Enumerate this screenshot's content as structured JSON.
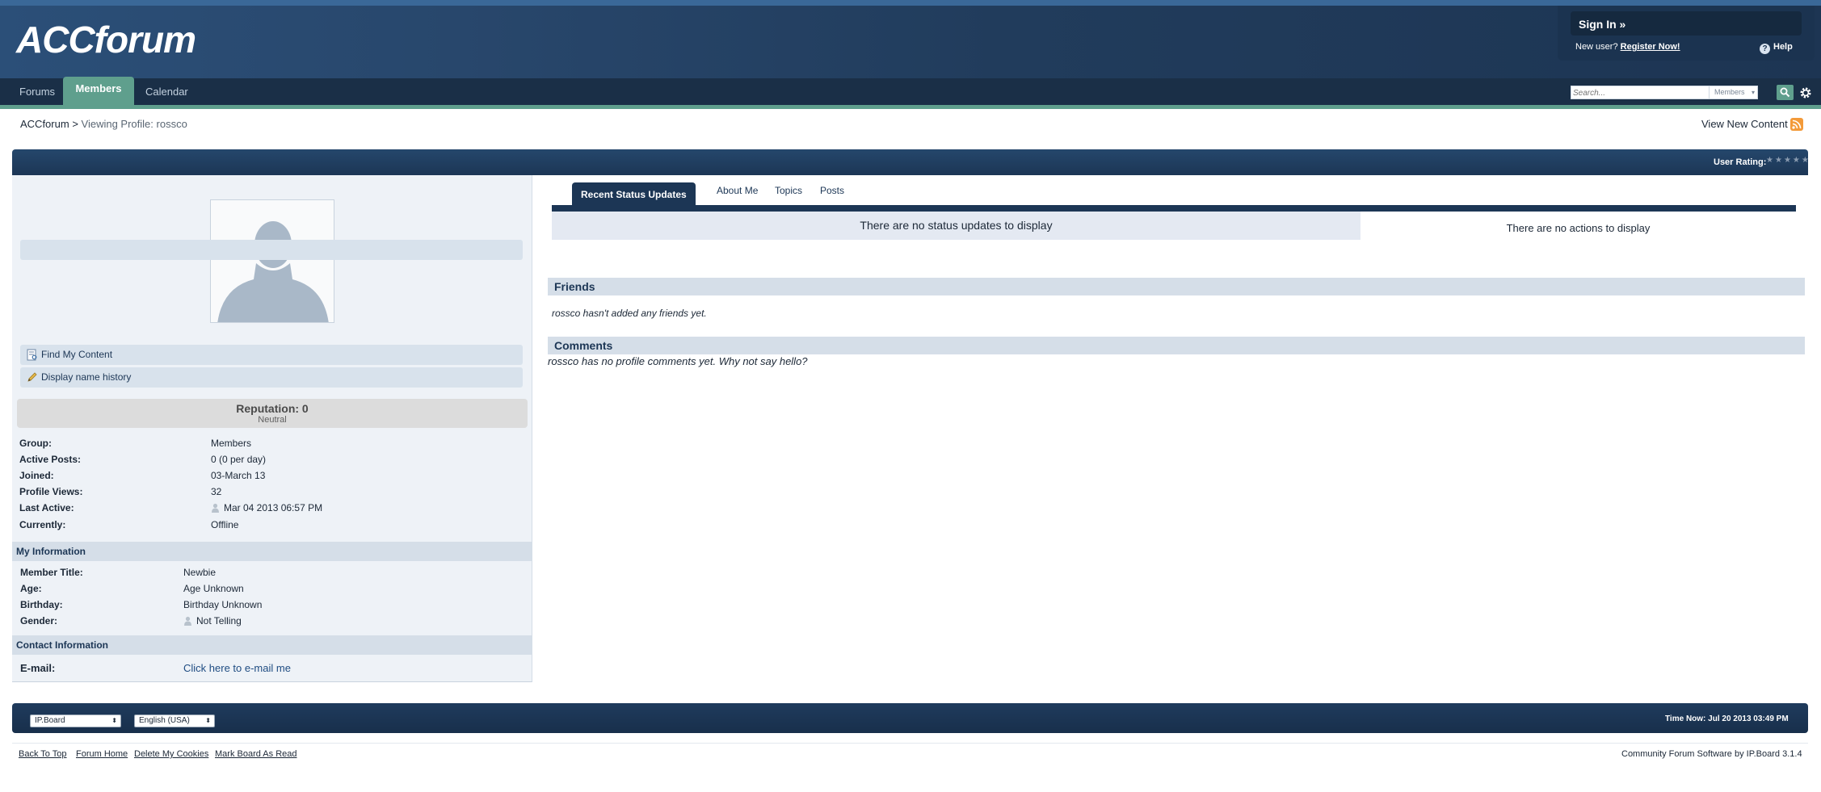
{
  "header": {
    "logo": "ACCforum",
    "sign_in": "Sign In »",
    "new_user": "New user?",
    "register": "Register Now!",
    "help": "Help"
  },
  "nav": {
    "tabs": [
      "Forums",
      "Members",
      "Calendar"
    ],
    "active": "Members"
  },
  "search": {
    "placeholder": "Search...",
    "scope": "Members"
  },
  "breadcrumb": {
    "home": "ACCforum",
    "separator": ">",
    "current": "Viewing Profile: rossco"
  },
  "view_new_content": "View New Content",
  "profile_bar": {
    "rating_label": "User Rating:",
    "stars": 0,
    "stars_max": 5
  },
  "left": {
    "links": [
      "Find My Content",
      "Display name history"
    ],
    "reputation": {
      "label": "Reputation: 0",
      "sub": "Neutral"
    },
    "stats": [
      {
        "label": "Group:",
        "value": "Members"
      },
      {
        "label": "Active Posts:",
        "value": "0 (0 per day)"
      },
      {
        "label": "Joined:",
        "value": "03-March 13"
      },
      {
        "label": "Profile Views:",
        "value": "32"
      },
      {
        "label": "Last Active:",
        "value": "Mar 04 2013 06:57 PM"
      },
      {
        "label": "Currently:",
        "value": "Offline"
      }
    ],
    "my_information": {
      "heading": "My Information",
      "rows": [
        {
          "label": "Member Title:",
          "value": "Newbie"
        },
        {
          "label": "Age:",
          "value": "Age Unknown"
        },
        {
          "label": "Birthday:",
          "value": "Birthday Unknown"
        },
        {
          "label": "Gender:",
          "value": "Not Telling"
        }
      ]
    },
    "contact": {
      "heading": "Contact Information",
      "email_label": "E-mail:",
      "email_link": "Click here to e-mail me"
    }
  },
  "right": {
    "tabs": [
      "Recent Status Updates",
      "About Me",
      "Topics",
      "Posts"
    ],
    "active_tab": "Recent Status Updates",
    "no_status": "There are no status updates to display",
    "no_actions": "There are no actions to display",
    "friends_heading": "Friends",
    "friends_text": "rossco hasn't added any friends yet.",
    "comments_heading": "Comments",
    "comments_text": "rossco has no profile comments yet. Why not say hello?"
  },
  "footer": {
    "skin": "IP.Board",
    "language": "English (USA)",
    "time_now": "Time Now: Jul 20 2013 03:49 PM",
    "links": [
      "Back To Top",
      "Forum Home",
      "Delete My Cookies",
      "Mark Board As Read"
    ],
    "powered_by": "Community Forum Software by IP.Board 3.1.4"
  },
  "colors": {
    "header": "#213c5c",
    "accent": "#5f9f8d",
    "bar": "#1c3655",
    "left_bg": "#eef2f7"
  }
}
